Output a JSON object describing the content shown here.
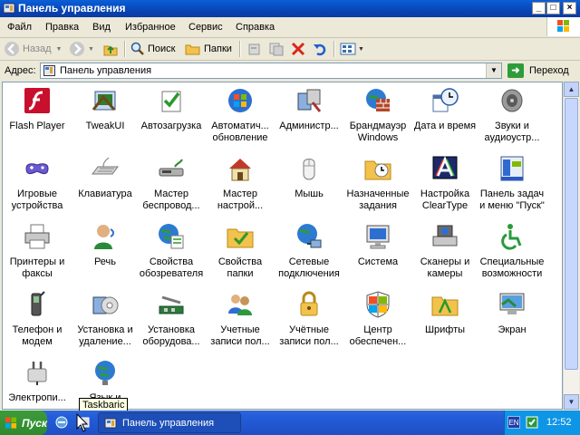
{
  "window": {
    "title": "Панель управления",
    "buttons": [
      "_",
      "□",
      "×"
    ]
  },
  "menu": [
    "Файл",
    "Правка",
    "Вид",
    "Избранное",
    "Сервис",
    "Справка"
  ],
  "toolbar": {
    "back": "Назад",
    "search": "Поиск",
    "folders": "Папки"
  },
  "address": {
    "label": "Адрес:",
    "value": "Панель управления",
    "go": "Переход"
  },
  "items": [
    {
      "label": "Flash Player",
      "icon": "flash-icon"
    },
    {
      "label": "TweakUI",
      "icon": "tweakui-icon"
    },
    {
      "label": "Автозагрузка",
      "icon": "autorun-icon"
    },
    {
      "label": "Автоматич... обновление",
      "icon": "windows-update-icon"
    },
    {
      "label": "Администр...",
      "icon": "admin-tools-icon"
    },
    {
      "label": "Брандмауэр Windows",
      "icon": "firewall-icon"
    },
    {
      "label": "Дата и время",
      "icon": "datetime-icon"
    },
    {
      "label": "Звуки и аудиоустр...",
      "icon": "sound-icon"
    },
    {
      "label": "Игровые устройства",
      "icon": "gamepad-icon"
    },
    {
      "label": "Клавиатура",
      "icon": "keyboard-icon"
    },
    {
      "label": "Мастер беспровод...",
      "icon": "wireless-wizard-icon"
    },
    {
      "label": "Мастер настрой...",
      "icon": "network-wizard-icon"
    },
    {
      "label": "Мышь",
      "icon": "mouse-icon"
    },
    {
      "label": "Назначенные задания",
      "icon": "scheduled-tasks-icon"
    },
    {
      "label": "Настройка ClearType",
      "icon": "cleartype-icon"
    },
    {
      "label": "Панель задач и меню \"Пуск\"",
      "icon": "taskbar-icon"
    },
    {
      "label": "Принтеры и факсы",
      "icon": "printer-icon"
    },
    {
      "label": "Речь",
      "icon": "speech-icon"
    },
    {
      "label": "Свойства обозревателя",
      "icon": "internet-options-icon"
    },
    {
      "label": "Свойства папки",
      "icon": "folder-options-icon"
    },
    {
      "label": "Сетевые подключения",
      "icon": "network-connections-icon"
    },
    {
      "label": "Система",
      "icon": "system-icon"
    },
    {
      "label": "Сканеры и камеры",
      "icon": "scanner-icon"
    },
    {
      "label": "Специальные возможности",
      "icon": "accessibility-icon"
    },
    {
      "label": "Телефон и модем",
      "icon": "phone-modem-icon"
    },
    {
      "label": "Установка и удаление...",
      "icon": "add-remove-icon"
    },
    {
      "label": "Установка оборудова...",
      "icon": "add-hardware-icon"
    },
    {
      "label": "Учетные записи пол...",
      "icon": "user-accounts-icon"
    },
    {
      "label": "Учётные записи пол...",
      "icon": "user-accounts-lock-icon"
    },
    {
      "label": "Центр обеспечен...",
      "icon": "security-center-icon"
    },
    {
      "label": "Шрифты",
      "icon": "fonts-icon"
    },
    {
      "label": "Экран",
      "icon": "display-icon"
    },
    {
      "label": "Электропи...",
      "icon": "power-icon"
    },
    {
      "label": "Язык и",
      "icon": "language-icon"
    }
  ],
  "tooltip": "Taskbaric",
  "taskbar": {
    "start": "Пуск",
    "task": "Панель управления",
    "lang": "EN",
    "clock": "12:52"
  }
}
